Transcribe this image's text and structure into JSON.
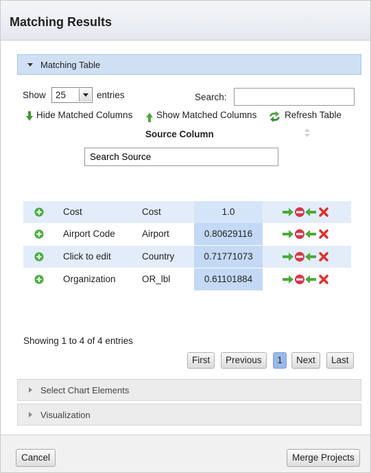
{
  "dialog": {
    "title": "Matching Results"
  },
  "matching_table": {
    "header": "Matching Table",
    "show_label": "Show",
    "page_size": "25",
    "entries_label": "entries",
    "search_label": "Search:",
    "search_value": "",
    "actions": {
      "hide": "Hide Matched Columns",
      "show": "Show Matched Columns",
      "refresh": "Refresh Table"
    },
    "column_header": "Source Column",
    "source_search_value": "Search Source",
    "rows": [
      {
        "source": "Cost",
        "target": "Cost",
        "score": "1.0"
      },
      {
        "source": "Airport Code",
        "target": "Airport",
        "score": "0.80629116"
      },
      {
        "source": "Click to edit",
        "target": "Country",
        "score": "0.71771073"
      },
      {
        "source": "Organization",
        "target": "OR_lbl",
        "score": "0.61101884"
      }
    ],
    "info": "Showing 1 to 4 of 4 entries",
    "pagination": {
      "first": "First",
      "previous": "Previous",
      "current": "1",
      "next": "Next",
      "last": "Last"
    }
  },
  "sections": {
    "chart_elements": "Select Chart Elements",
    "visualization": "Visualization"
  },
  "footer": {
    "cancel": "Cancel",
    "merge": "Merge Projects"
  },
  "colors": {
    "accent": "#cfe0f4",
    "score_highlight": "#c3d9f5",
    "current_page": "#9ab8e8"
  }
}
